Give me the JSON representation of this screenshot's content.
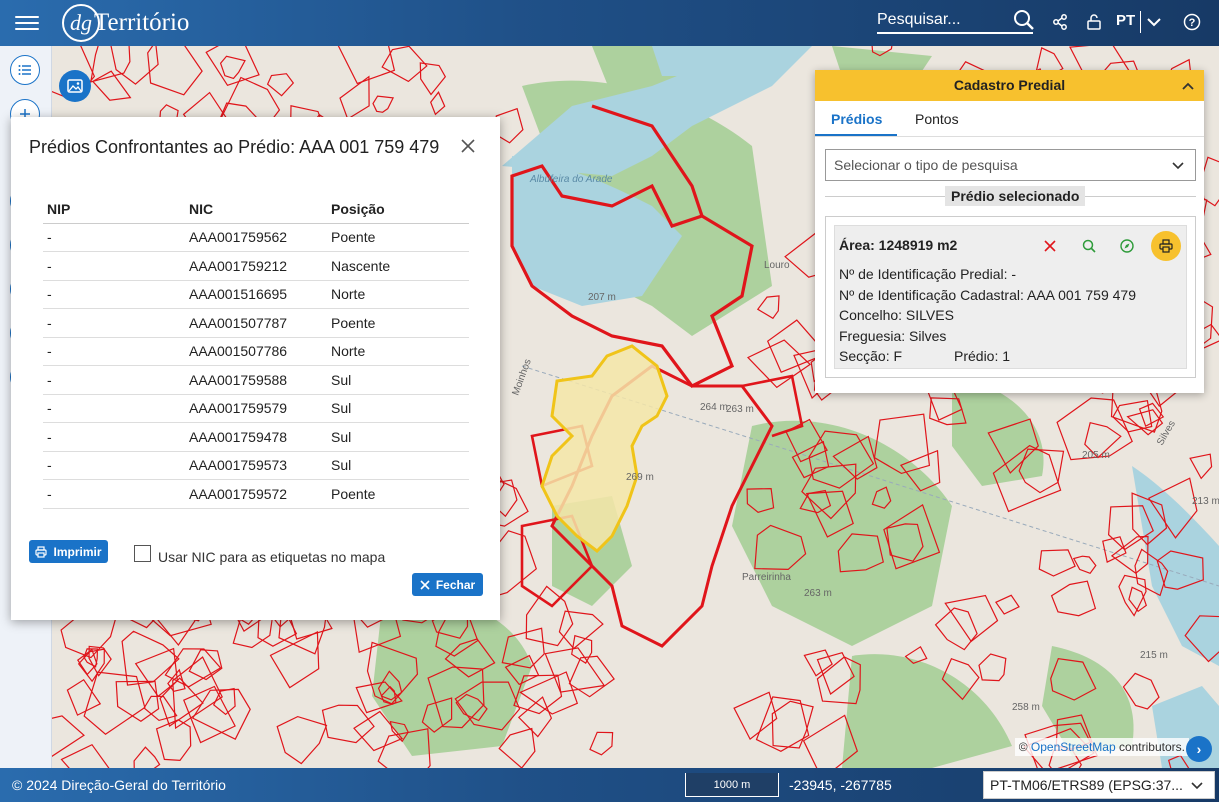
{
  "header": {
    "logo_mark": "dg",
    "logo_text": "Território",
    "search_placeholder": "Pesquisar...",
    "language": "PT",
    "icons": [
      "search-icon",
      "share-icon",
      "lock-icon",
      "chevron-down-icon",
      "help-icon"
    ]
  },
  "dialog": {
    "title": "Prédios Confrontantes ao Prédio: AAA 001 759 479",
    "columns": [
      "NIP",
      "NIC",
      "Posição"
    ],
    "rows": [
      {
        "nip": "-",
        "nic": "AAA001759562",
        "posicao": "Poente"
      },
      {
        "nip": "-",
        "nic": "AAA001759212",
        "posicao": "Nascente"
      },
      {
        "nip": "-",
        "nic": "AAA001516695",
        "posicao": "Norte"
      },
      {
        "nip": "-",
        "nic": "AAA001507787",
        "posicao": "Poente"
      },
      {
        "nip": "-",
        "nic": "AAA001507786",
        "posicao": "Norte"
      },
      {
        "nip": "-",
        "nic": "AAA001759588",
        "posicao": "Sul"
      },
      {
        "nip": "-",
        "nic": "AAA001759579",
        "posicao": "Sul"
      },
      {
        "nip": "-",
        "nic": "AAA001759478",
        "posicao": "Sul"
      },
      {
        "nip": "-",
        "nic": "AAA001759573",
        "posicao": "Sul"
      },
      {
        "nip": "-",
        "nic": "AAA001759572",
        "posicao": "Poente"
      }
    ],
    "print_label": "Imprimir",
    "checkbox_label": "Usar NIC para as etiquetas no mapa",
    "checkbox_checked": false,
    "close_label": "Fechar"
  },
  "panel": {
    "title": "Cadastro Predial",
    "tabs": [
      "Prédios",
      "Pontos"
    ],
    "active_tab": "Prédios",
    "select_placeholder": "Selecionar o tipo de pesquisa",
    "selected_label": "Prédio selecionado",
    "area": "Área: 1248919 m2",
    "nip": "Nº de Identificação Predial: -",
    "nic": "Nº de Identificação Cadastral: AAA 001 759 479",
    "concelho": "Concelho: SILVES",
    "freguesia": "Freguesia: Silves",
    "seccao": "Secção: F",
    "predio": "Prédio: 1"
  },
  "map": {
    "labels": [
      "Albufeira do Arade",
      "207 m",
      "264 m",
      "263 m",
      "269 m",
      "Parreirinha",
      "263 m",
      "205 m",
      "213 m",
      "215 m",
      "258 m",
      "Louro",
      "Silves",
      "Moinhos"
    ],
    "attribution_prefix": "© ",
    "attribution_link": "OpenStreetMap",
    "attribution_suffix": " contributors.",
    "colors": {
      "parcel_border": "#e0151b",
      "selected_fill": "#f5e6a8",
      "selected_border": "#f0c419",
      "water": "#aad3df",
      "forest": "#add19e"
    }
  },
  "footer": {
    "copyright": "© 2024 Direção-Geral do Território",
    "scale": "1000 m",
    "coords": "-23945, -267785",
    "crs": "PT-TM06/ETRS89 (EPSG:37..."
  }
}
